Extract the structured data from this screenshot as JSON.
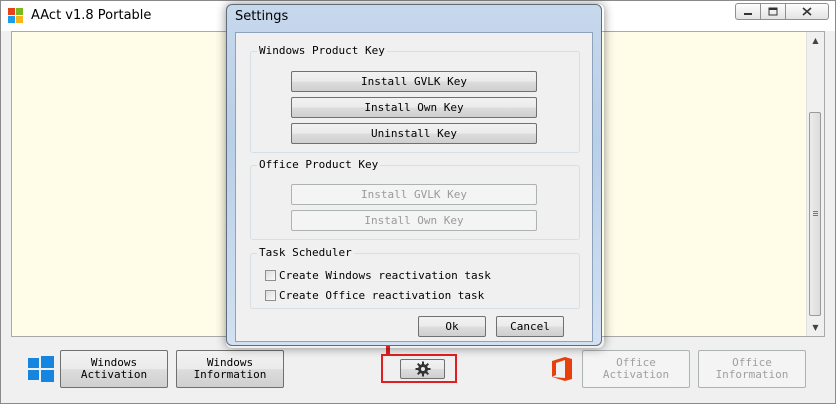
{
  "app": {
    "title": "AAct v1.8 Portable",
    "window_controls": [
      "minimize",
      "maximize",
      "close"
    ]
  },
  "log": {
    "text": "",
    "background": "#fffde8"
  },
  "bottom_bar": {
    "windows_activation": "Windows\nActivation",
    "windows_information": "Windows\nInformation",
    "settings_icon": "gear-icon",
    "office_activation": "Office\nActivation",
    "office_information": "Office\nInformation"
  },
  "settings_dialog": {
    "title": "Settings",
    "windows_group": {
      "label": "Windows Product Key",
      "install_gvlk": "Install GVLK Key",
      "install_own": "Install Own Key",
      "uninstall": "Uninstall Key"
    },
    "office_group": {
      "label": "Office Product Key",
      "install_gvlk": "Install GVLK Key",
      "install_own": "Install Own Key"
    },
    "scheduler_group": {
      "label": "Task Scheduler",
      "windows_task": "Create Windows reactivation task",
      "office_task": "Create Office reactivation task",
      "windows_task_checked": false,
      "office_task_checked": false
    },
    "ok": "Ok",
    "cancel": "Cancel"
  },
  "colors": {
    "highlight": "#e02020",
    "windows_logo": "#1685e0",
    "office_logo": "#e8400c",
    "dialog_frame": "#b9cfe8"
  }
}
